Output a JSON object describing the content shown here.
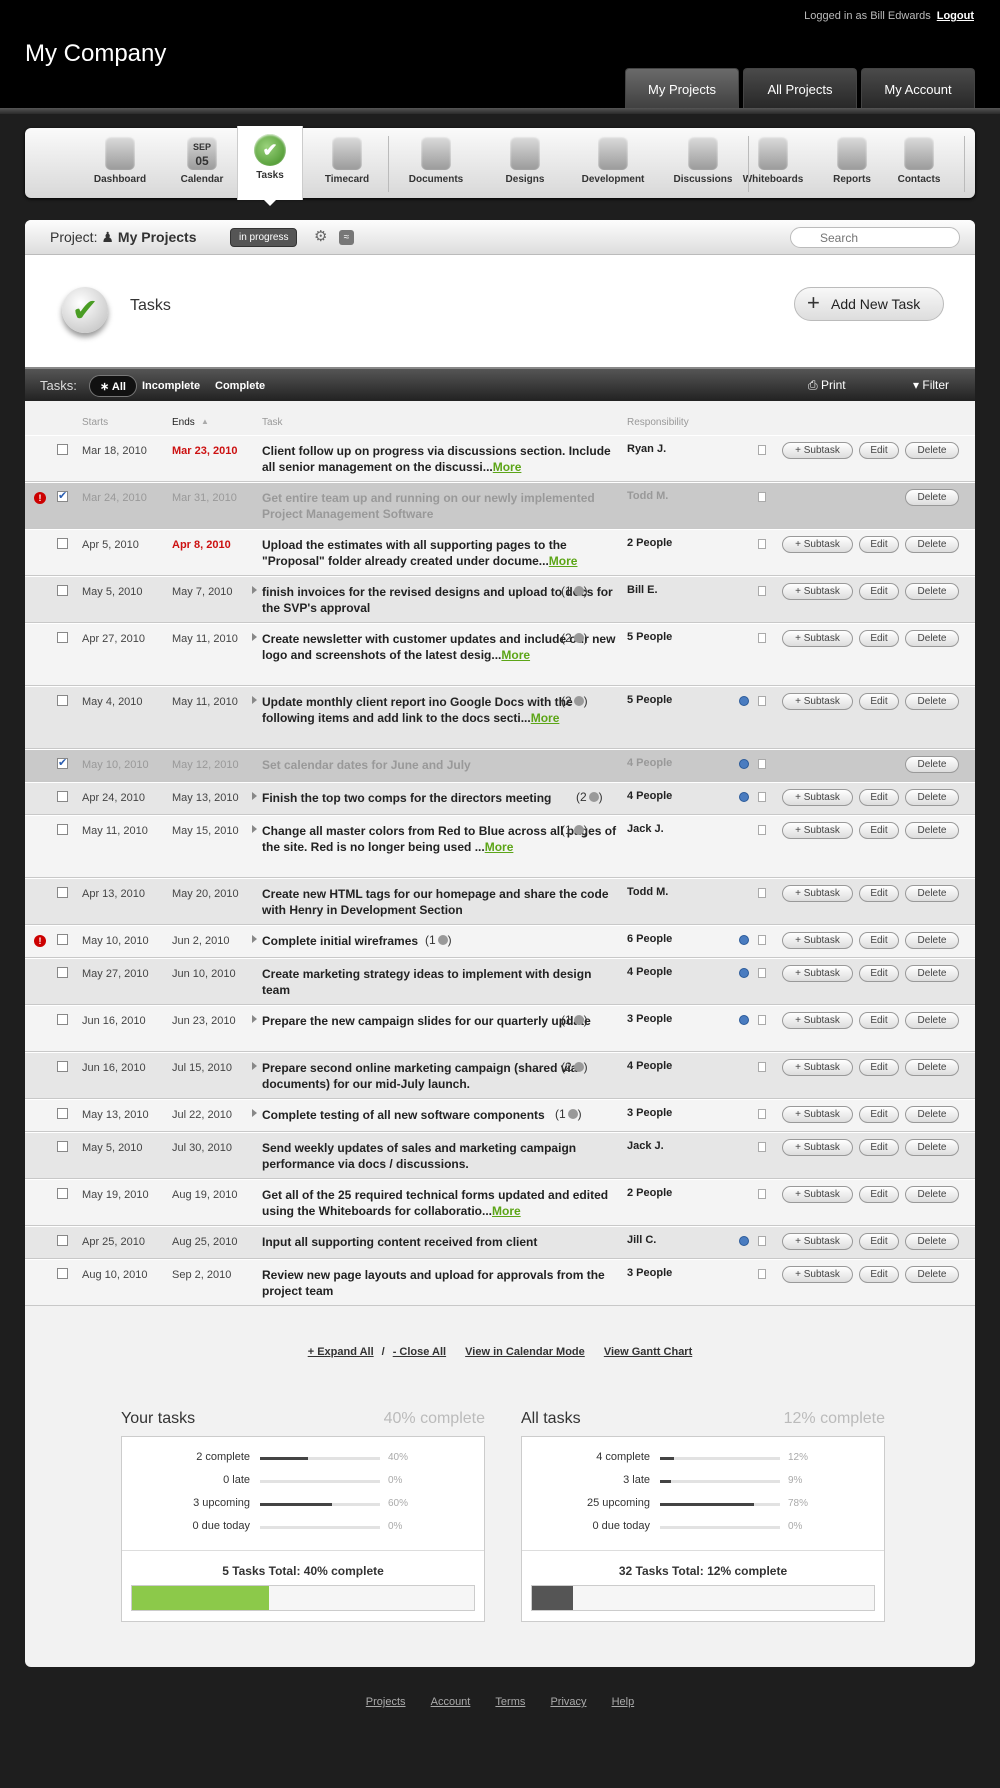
{
  "header": {
    "logged_in": "Logged in as Bill Edwards",
    "logout": "Logout",
    "logo": "My Company",
    "tabs": [
      "My Projects",
      "All Projects",
      "My Account"
    ]
  },
  "toolbar": [
    "Dashboard",
    "Calendar",
    "Tasks",
    "Timecard",
    "Documents",
    "Designs",
    "Development",
    "Discussions",
    "Whiteboards",
    "Reports",
    "Contacts"
  ],
  "calendar_icon": {
    "month": "SEP",
    "day": "05"
  },
  "project": {
    "label": "Project:",
    "name": "My Projects",
    "status": "in progress",
    "search_placeholder": "Search"
  },
  "page": {
    "title": "Tasks",
    "add_button": "Add New Task"
  },
  "filter": {
    "label": "Tasks:",
    "tabs": [
      "All",
      "Incomplete",
      "Complete"
    ],
    "active": "All",
    "print": "Print",
    "filter": "Filter"
  },
  "columns": {
    "starts": "Starts",
    "ends": "Ends",
    "task": "Task",
    "responsibility": "Responsibility"
  },
  "buttons": {
    "subtask": "+ Subtask",
    "edit": "Edit",
    "delete": "Delete"
  },
  "more_label": "More",
  "tasks": [
    {
      "starts": "Mar 18, 2010",
      "ends": "Mar 23, 2010",
      "late": true,
      "text": "Client follow up on progress via discussions section. Include all senior management on the discussi...",
      "more": true,
      "resp": "Ryan J.",
      "checked": false,
      "alert": false,
      "done": false,
      "tri": false,
      "count": "",
      "clock": false
    },
    {
      "starts": "Mar 24, 2010",
      "ends": "Mar 31, 2010",
      "late": false,
      "text": "Get entire team up and running on our newly implemented Project Management Software",
      "more": false,
      "resp": "Todd M.",
      "checked": true,
      "alert": true,
      "done": true,
      "tri": false,
      "count": "",
      "clock": false
    },
    {
      "starts": "Apr 5, 2010",
      "ends": "Apr 8, 2010",
      "late": true,
      "text": "Upload the estimates with all supporting pages to the \"Proposal\" folder already created under docume...",
      "more": true,
      "resp": "2 People",
      "checked": false,
      "alert": false,
      "done": false,
      "tri": false,
      "count": "",
      "clock": false
    },
    {
      "starts": "May 5, 2010",
      "ends": "May 7, 2010",
      "late": false,
      "text": "finish invoices for the revised designs and upload to docs for the SVP's approval",
      "more": false,
      "resp": "Bill E.",
      "checked": false,
      "alert": false,
      "done": false,
      "tri": true,
      "count": "(1",
      "clock": false
    },
    {
      "starts": "Apr 27, 2010",
      "ends": "May 11, 2010",
      "late": false,
      "text": "Create newsletter with customer updates and include our new logo and screenshots of the latest desig...",
      "more": true,
      "resp": "5 People",
      "checked": false,
      "alert": false,
      "done": false,
      "tri": true,
      "count": "(2",
      "clock": false
    },
    {
      "starts": "May 4, 2010",
      "ends": "May 11, 2010",
      "late": false,
      "text": "Update monthly client report ino Google Docs with the following items and add link to the docs secti...",
      "more": true,
      "resp": "5 People",
      "checked": false,
      "alert": false,
      "done": false,
      "tri": true,
      "count": "(2",
      "clock": true
    },
    {
      "starts": "May 10, 2010",
      "ends": "May 12, 2010",
      "late": false,
      "text": "Set calendar dates for June and July",
      "more": false,
      "resp": "4 People",
      "checked": true,
      "alert": false,
      "done": true,
      "tri": false,
      "count": "",
      "clock": true
    },
    {
      "starts": "Apr 24, 2010",
      "ends": "May 13, 2010",
      "late": false,
      "text": "Finish the top two comps for the directors meeting",
      "more": false,
      "resp": "4 People",
      "checked": false,
      "alert": false,
      "done": false,
      "tri": true,
      "count": "(2",
      "clock": true
    },
    {
      "starts": "May 11, 2010",
      "ends": "May 15, 2010",
      "late": false,
      "text": "Change all master colors from Red to Blue across all pages of the site. Red is no longer being used ...",
      "more": true,
      "resp": "Jack J.",
      "checked": false,
      "alert": false,
      "done": false,
      "tri": true,
      "count": "(1",
      "clock": false
    },
    {
      "starts": "Apr 13, 2010",
      "ends": "May 20, 2010",
      "late": false,
      "text": "Create new HTML tags for our homepage and share the code with Henry in Development Section",
      "more": false,
      "resp": "Todd M.",
      "checked": false,
      "alert": false,
      "done": false,
      "tri": false,
      "count": "",
      "clock": false
    },
    {
      "starts": "May 10, 2010",
      "ends": "Jun 2, 2010",
      "late": false,
      "text": "Complete initial wireframes",
      "more": false,
      "resp": "6 People",
      "checked": false,
      "alert": true,
      "done": false,
      "tri": true,
      "count": "(1",
      "clock": true
    },
    {
      "starts": "May 27, 2010",
      "ends": "Jun 10, 2010",
      "late": false,
      "text": "Create marketing strategy ideas to implement with design team",
      "more": false,
      "resp": "4 People",
      "checked": false,
      "alert": false,
      "done": false,
      "tri": false,
      "count": "",
      "clock": true
    },
    {
      "starts": "Jun 16, 2010",
      "ends": "Jun 23, 2010",
      "late": false,
      "text": "Prepare the new campaign slides for our quarterly update",
      "more": false,
      "resp": "3 People",
      "checked": false,
      "alert": false,
      "done": false,
      "tri": true,
      "count": "(1",
      "clock": true
    },
    {
      "starts": "Jun 16, 2010",
      "ends": "Jul 15, 2010",
      "late": false,
      "text": "Prepare second online marketing campaign (shared via documents) for our mid-July launch.",
      "more": false,
      "resp": "4 People",
      "checked": false,
      "alert": false,
      "done": false,
      "tri": true,
      "count": "(2",
      "clock": false
    },
    {
      "starts": "May 13, 2010",
      "ends": "Jul 22, 2010",
      "late": false,
      "text": "Complete testing of all new software components",
      "more": false,
      "resp": "3 People",
      "checked": false,
      "alert": false,
      "done": false,
      "tri": true,
      "count": "(1",
      "clock": false
    },
    {
      "starts": "May 5, 2010",
      "ends": "Jul 30, 2010",
      "late": false,
      "text": "Send weekly updates of sales and marketing campaign performance via docs / discussions.",
      "more": false,
      "resp": "Jack J.",
      "checked": false,
      "alert": false,
      "done": false,
      "tri": false,
      "count": "",
      "clock": false
    },
    {
      "starts": "May 19, 2010",
      "ends": "Aug 19, 2010",
      "late": false,
      "text": "Get all of the 25 required technical forms updated and edited using the Whiteboards for collaboratio...",
      "more": true,
      "resp": "2 People",
      "checked": false,
      "alert": false,
      "done": false,
      "tri": false,
      "count": "",
      "clock": false
    },
    {
      "starts": "Apr 25, 2010",
      "ends": "Aug 25, 2010",
      "late": false,
      "text": "Input all supporting content received from client",
      "more": false,
      "resp": "Jill C.",
      "checked": false,
      "alert": false,
      "done": false,
      "tri": false,
      "count": "",
      "clock": true
    },
    {
      "starts": "Aug 10, 2010",
      "ends": "Sep 2, 2010",
      "late": false,
      "text": "Review new page layouts and upload for approvals from the project team",
      "more": false,
      "resp": "3 People",
      "checked": false,
      "alert": false,
      "done": false,
      "tri": false,
      "count": "",
      "clock": false
    }
  ],
  "links": {
    "expand": "+ Expand All",
    "sep": "/",
    "close": "- Close All",
    "calendar": "View in Calendar Mode",
    "gantt": "View Gantt Chart"
  },
  "summary": [
    {
      "title": "Your tasks",
      "pct": "40% complete",
      "rows": [
        {
          "label": "2 complete",
          "value": "40%",
          "fraction": 0.4
        },
        {
          "label": "0 late",
          "value": "0%",
          "fraction": 0
        },
        {
          "label": "3 upcoming",
          "value": "60%",
          "fraction": 0.6
        },
        {
          "label": "0 due today",
          "value": "0%",
          "fraction": 0
        }
      ],
      "total": "5 Tasks Total: 40% complete",
      "total_fraction": 0.4,
      "color": "#8cc94a"
    },
    {
      "title": "All tasks",
      "pct": "12% complete",
      "rows": [
        {
          "label": "4 complete",
          "value": "12%",
          "fraction": 0.12
        },
        {
          "label": "3 late",
          "value": "9%",
          "fraction": 0.09
        },
        {
          "label": "25 upcoming",
          "value": "78%",
          "fraction": 0.78
        },
        {
          "label": "0 due today",
          "value": "0%",
          "fraction": 0
        }
      ],
      "total": "32 Tasks Total: 12% complete",
      "total_fraction": 0.12,
      "color": "#555555"
    }
  ],
  "footer": [
    "Projects",
    "Account",
    "Terms",
    "Privacy",
    "Help"
  ]
}
